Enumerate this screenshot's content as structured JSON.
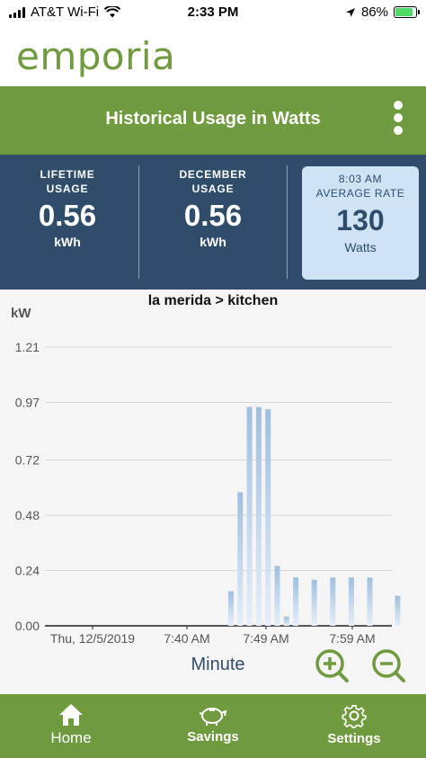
{
  "status": {
    "carrier": "AT&T Wi-Fi",
    "time": "2:33 PM",
    "battery": "86%"
  },
  "logo": {
    "text": "emporia"
  },
  "header": {
    "title": "Historical Usage in Watts"
  },
  "stats": {
    "lifetime": {
      "label_line1": "LIFETIME",
      "label_line2": "USAGE",
      "value": "0.56",
      "unit": "kWh"
    },
    "month": {
      "label_line1": "DECEMBER",
      "label_line2": "USAGE",
      "value": "0.56",
      "unit": "kWh"
    },
    "rate": {
      "label_line1": "8:03 AM",
      "label_line2": "AVERAGE RATE",
      "value": "130",
      "unit": "Watts"
    }
  },
  "chart_data": {
    "type": "bar",
    "title": "la merida > kitchen",
    "ylabel": "kW",
    "xlabel": "Minute",
    "ylim": [
      0,
      1.21
    ],
    "y_ticks": [
      "1.21",
      "0.97",
      "0.72",
      "0.48",
      "0.24",
      "0.00"
    ],
    "x_ticks": [
      "Thu, 12/5/2019",
      "7:40 AM",
      "7:49 AM",
      "7:59 AM"
    ],
    "grid": true,
    "bars": [
      {
        "x": 0.0,
        "value": 0.15
      },
      {
        "x": 1.0,
        "value": 0.58
      },
      {
        "x": 2.0,
        "value": 0.95
      },
      {
        "x": 3.0,
        "value": 0.95
      },
      {
        "x": 4.0,
        "value": 0.94
      },
      {
        "x": 5.0,
        "value": 0.26
      },
      {
        "x": 6.0,
        "value": 0.04
      },
      {
        "x": 7.0,
        "value": 0.21
      },
      {
        "x": 9.0,
        "value": 0.2
      },
      {
        "x": 11.0,
        "value": 0.21
      },
      {
        "x": 13.0,
        "value": 0.21
      },
      {
        "x": 15.0,
        "value": 0.21
      },
      {
        "x": 18.0,
        "value": 0.13
      }
    ]
  },
  "zoom": {
    "in": "zoom-in",
    "out": "zoom-out"
  },
  "nav": {
    "home": "Home",
    "savings": "Savings",
    "settings": "Settings"
  }
}
